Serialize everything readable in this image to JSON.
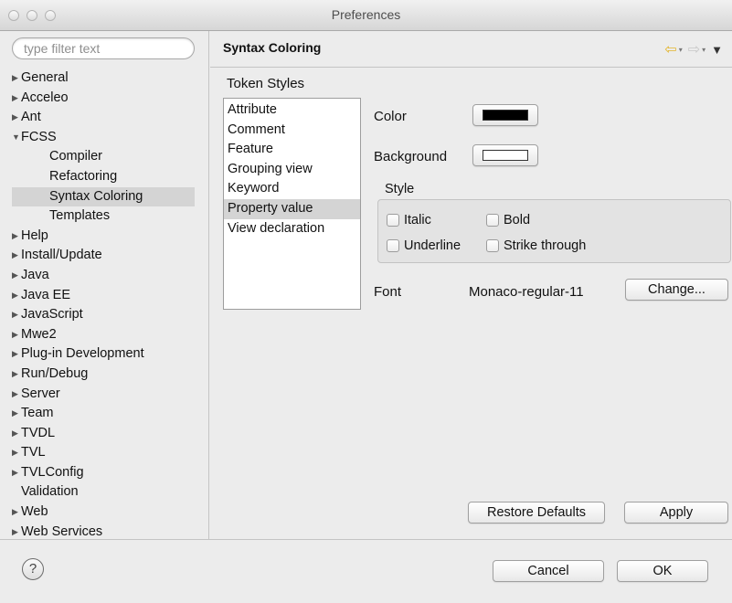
{
  "window": {
    "title": "Preferences"
  },
  "filter": {
    "placeholder": "type filter text"
  },
  "tree": [
    {
      "label": "General",
      "arrow": "▶",
      "child": false,
      "selected": false
    },
    {
      "label": "Acceleo",
      "arrow": "▶",
      "child": false,
      "selected": false
    },
    {
      "label": "Ant",
      "arrow": "▶",
      "child": false,
      "selected": false
    },
    {
      "label": "FCSS",
      "arrow": "▼",
      "child": false,
      "selected": false
    },
    {
      "label": "Compiler",
      "arrow": "",
      "child": true,
      "selected": false
    },
    {
      "label": "Refactoring",
      "arrow": "",
      "child": true,
      "selected": false
    },
    {
      "label": "Syntax Coloring",
      "arrow": "",
      "child": true,
      "selected": true
    },
    {
      "label": "Templates",
      "arrow": "",
      "child": true,
      "selected": false
    },
    {
      "label": "Help",
      "arrow": "▶",
      "child": false,
      "selected": false
    },
    {
      "label": "Install/Update",
      "arrow": "▶",
      "child": false,
      "selected": false
    },
    {
      "label": "Java",
      "arrow": "▶",
      "child": false,
      "selected": false
    },
    {
      "label": "Java EE",
      "arrow": "▶",
      "child": false,
      "selected": false
    },
    {
      "label": "JavaScript",
      "arrow": "▶",
      "child": false,
      "selected": false
    },
    {
      "label": "Mwe2",
      "arrow": "▶",
      "child": false,
      "selected": false
    },
    {
      "label": "Plug-in Development",
      "arrow": "▶",
      "child": false,
      "selected": false
    },
    {
      "label": "Run/Debug",
      "arrow": "▶",
      "child": false,
      "selected": false
    },
    {
      "label": "Server",
      "arrow": "▶",
      "child": false,
      "selected": false
    },
    {
      "label": "Team",
      "arrow": "▶",
      "child": false,
      "selected": false
    },
    {
      "label": "TVDL",
      "arrow": "▶",
      "child": false,
      "selected": false
    },
    {
      "label": "TVL",
      "arrow": "▶",
      "child": false,
      "selected": false
    },
    {
      "label": "TVLConfig",
      "arrow": "▶",
      "child": false,
      "selected": false
    },
    {
      "label": "Validation",
      "arrow": "",
      "child": false,
      "selected": false
    },
    {
      "label": "Web",
      "arrow": "▶",
      "child": false,
      "selected": false
    },
    {
      "label": "Web Services",
      "arrow": "▶",
      "child": false,
      "selected": false
    }
  ],
  "page": {
    "title": "Syntax Coloring"
  },
  "token_styles": {
    "label": "Token Styles",
    "items": [
      "Attribute",
      "Comment",
      "Feature",
      "Grouping view",
      "Keyword",
      "Property value",
      "View declaration"
    ],
    "selected": "Property value"
  },
  "options": {
    "color_label": "Color",
    "color_value": "#000000",
    "background_label": "Background",
    "background_value": "#ffffff",
    "style_label": "Style",
    "italic_label": "Italic",
    "bold_label": "Bold",
    "underline_label": "Underline",
    "strike_label": "Strike through",
    "font_label": "Font",
    "font_value": "Monaco-regular-11",
    "change_label": "Change..."
  },
  "buttons": {
    "restore_defaults": "Restore Defaults",
    "apply": "Apply",
    "cancel": "Cancel",
    "ok": "OK"
  },
  "icons": {
    "back": "back-arrow-icon",
    "forward": "forward-arrow-icon",
    "menu": "view-menu-icon",
    "help": "help-icon"
  }
}
